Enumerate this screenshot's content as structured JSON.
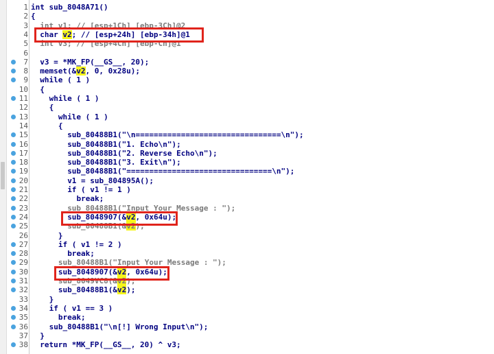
{
  "function_header": "int sub_8048A71()",
  "highlighted_token": "v2",
  "colors": {
    "code_text": "#000080",
    "comment_text": "#7a7a7a",
    "line_number": "#5a5a5a",
    "breakpoint_dot": "#4aa3df",
    "highlight": "#f5f51a",
    "annotation_box": "#e0241c"
  },
  "lines": [
    {
      "num": "1",
      "text": "int sub_8048A71()",
      "dot": false,
      "indent": 0
    },
    {
      "num": "2",
      "text": "{",
      "dot": false,
      "indent": 0
    },
    {
      "num": "3",
      "text": "int v1; // [esp+1Ch] [ebp-3Ch]@2",
      "dot": false,
      "indent": 1,
      "style": "partial"
    },
    {
      "num": "4",
      "pre": "char ",
      "hl": "v2",
      "post": "; // [esp+24h] [ebp-34h]@1",
      "dot": false,
      "indent": 1
    },
    {
      "num": "5",
      "text": "int v3; // [esp+4Ch] [ebp-Ch]@1",
      "dot": false,
      "indent": 1,
      "style": "partial"
    },
    {
      "num": "6",
      "text": "",
      "dot": false,
      "indent": 0
    },
    {
      "num": "7",
      "text": "v3 = *MK_FP(__GS__, 20);",
      "dot": true,
      "indent": 1
    },
    {
      "num": "8",
      "pre": "memset(&",
      "hl": "v2",
      "post": ", 0, 0x28u);",
      "dot": true,
      "indent": 1
    },
    {
      "num": "9",
      "text": "while ( 1 )",
      "dot": true,
      "indent": 1
    },
    {
      "num": "10",
      "text": "{",
      "dot": false,
      "indent": 1
    },
    {
      "num": "11",
      "text": "while ( 1 )",
      "dot": true,
      "indent": 2
    },
    {
      "num": "12",
      "text": "{",
      "dot": false,
      "indent": 2
    },
    {
      "num": "13",
      "text": "while ( 1 )",
      "dot": true,
      "indent": 3
    },
    {
      "num": "14",
      "text": "{",
      "dot": false,
      "indent": 3
    },
    {
      "num": "15",
      "text": "sub_80488B1(\"\\n================================\\n\");",
      "dot": true,
      "indent": 4
    },
    {
      "num": "16",
      "text": "sub_80488B1(\"1. Echo\\n\");",
      "dot": true,
      "indent": 4
    },
    {
      "num": "17",
      "text": "sub_80488B1(\"2. Reverse Echo\\n\");",
      "dot": true,
      "indent": 4
    },
    {
      "num": "18",
      "text": "sub_80488B1(\"3. Exit\\n\");",
      "dot": true,
      "indent": 4
    },
    {
      "num": "19",
      "text": "sub_80488B1(\"================================\\n\");",
      "dot": true,
      "indent": 4
    },
    {
      "num": "20",
      "text": "v1 = sub_804895A();",
      "dot": true,
      "indent": 4
    },
    {
      "num": "21",
      "text": "if ( v1 != 1 )",
      "dot": true,
      "indent": 4
    },
    {
      "num": "22",
      "text": "break;",
      "dot": true,
      "indent": 5
    },
    {
      "num": "23",
      "text": "sub_80488B1(\"Input Your Message : \");",
      "dot": true,
      "indent": 4,
      "style": "partial"
    },
    {
      "num": "24",
      "pre": "sub_8048907(&",
      "hl": "v2",
      "post": ", 0x64u);",
      "dot": true,
      "indent": 4
    },
    {
      "num": "25",
      "pre": "sub_80488B1(&",
      "hl": "v2",
      "post": ");",
      "dot": true,
      "indent": 4,
      "style": "partial"
    },
    {
      "num": "26",
      "text": "}",
      "dot": false,
      "indent": 3
    },
    {
      "num": "27",
      "text": "if ( v1 != 2 )",
      "dot": true,
      "indent": 3
    },
    {
      "num": "28",
      "text": "break;",
      "dot": true,
      "indent": 4
    },
    {
      "num": "29",
      "text": "sub_80488B1(\"Input Your Message : \");",
      "dot": true,
      "indent": 3,
      "style": "partial"
    },
    {
      "num": "30",
      "pre": "sub_8048907(&",
      "hl": "v2",
      "post": ", 0x64u);",
      "dot": true,
      "indent": 3
    },
    {
      "num": "31",
      "pre": "sub_8049VC8(&",
      "hl": "v2",
      "post": ");",
      "dot": true,
      "indent": 3,
      "style": "partial"
    },
    {
      "num": "32",
      "pre": "sub_80488B1(&",
      "hl": "v2",
      "post": ");",
      "dot": true,
      "indent": 3
    },
    {
      "num": "33",
      "text": "}",
      "dot": false,
      "indent": 2
    },
    {
      "num": "34",
      "text": "if ( v1 == 3 )",
      "dot": true,
      "indent": 2
    },
    {
      "num": "35",
      "text": "break;",
      "dot": true,
      "indent": 3
    },
    {
      "num": "36",
      "text": "sub_80488B1(\"\\n[!] Wrong Input\\n\");",
      "dot": true,
      "indent": 2
    },
    {
      "num": "37",
      "text": "}",
      "dot": false,
      "indent": 1
    },
    {
      "num": "38",
      "text": "return *MK_FP(__GS__, 20) ^ v3;",
      "dot": true,
      "indent": 1
    }
  ]
}
